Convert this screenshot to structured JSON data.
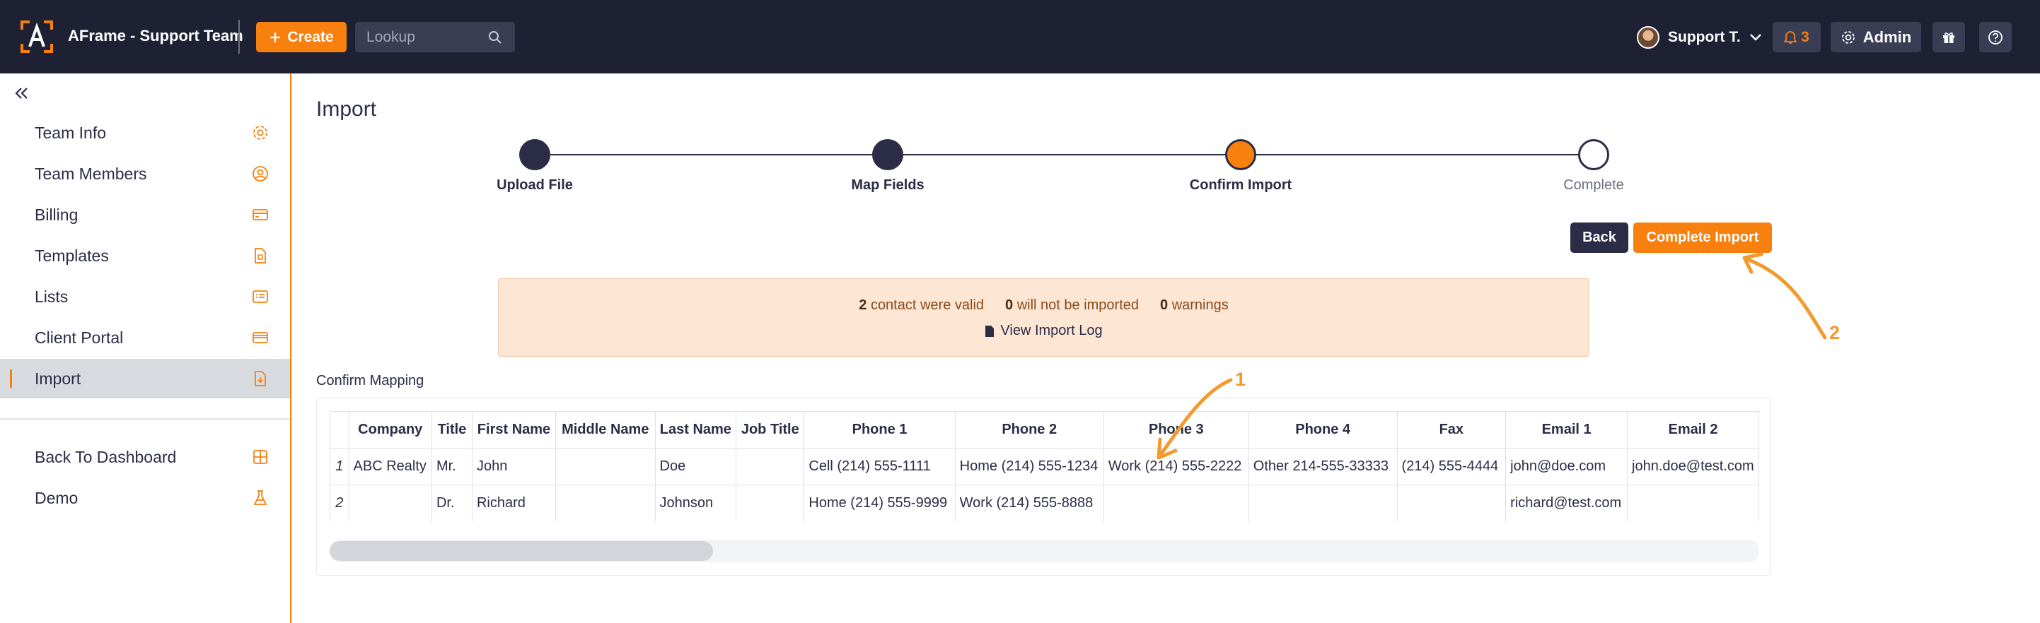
{
  "header": {
    "app_title": "AFrame - Support Team",
    "create_label": "Create",
    "lookup_placeholder": "Lookup",
    "user_name": "Support T.",
    "notification_count": "3",
    "admin_label": "Admin",
    "icons": [
      "aframe-logo-icon",
      "plus-icon",
      "search-icon",
      "chevron-down-icon",
      "bell-icon",
      "gear-icon",
      "gift-icon",
      "help-icon"
    ]
  },
  "sidebar": {
    "items": [
      {
        "label": "Team Info",
        "icon": "gear-icon"
      },
      {
        "label": "Team Members",
        "icon": "user-circle-icon"
      },
      {
        "label": "Billing",
        "icon": "credit-card-icon"
      },
      {
        "label": "Templates",
        "icon": "file-template-icon"
      },
      {
        "label": "Lists",
        "icon": "list-icon"
      },
      {
        "label": "Client Portal",
        "icon": "portal-card-icon"
      },
      {
        "label": "Import",
        "icon": "file-import-icon",
        "active": true
      }
    ],
    "secondary": [
      {
        "label": "Back To Dashboard",
        "icon": "dashboard-grid-icon"
      },
      {
        "label": "Demo",
        "icon": "flask-icon"
      }
    ]
  },
  "main": {
    "title": "Import",
    "steps": [
      {
        "label": "Upload File",
        "state": "done"
      },
      {
        "label": "Map Fields",
        "state": "done"
      },
      {
        "label": "Confirm Import",
        "state": "current"
      },
      {
        "label": "Complete",
        "state": "todo"
      }
    ],
    "back_label": "Back",
    "complete_label": "Complete Import",
    "summary": {
      "valid_count": "2",
      "valid_text": "contact were valid",
      "not_imported_count": "0",
      "not_imported_text": "will not be imported",
      "warnings_count": "0",
      "warnings_text": "warnings",
      "view_log_label": "View Import Log"
    },
    "mapping_label": "Confirm Mapping",
    "table": {
      "columns": [
        "",
        "Company",
        "Title",
        "First Name",
        "Middle Name",
        "Last Name",
        "Job Title",
        "Phone 1",
        "Phone 2",
        "Phone 3",
        "Phone 4",
        "Fax",
        "Email 1",
        "Email 2"
      ],
      "rows": [
        [
          "1",
          "ABC Realty",
          "Mr.",
          "John",
          "",
          "Doe",
          "",
          "Cell (214) 555-1111",
          "Home (214) 555-1234",
          "Work (214) 555-2222",
          "Other 214-555-33333",
          "(214) 555-4444",
          "john@doe.com",
          "john.doe@test.com"
        ],
        [
          "2",
          "",
          "Dr.",
          "Richard",
          "",
          "Johnson",
          "",
          "Home (214) 555-9999",
          "Work (214) 555-8888",
          "",
          "",
          "",
          "richard@test.com",
          ""
        ]
      ]
    },
    "annotations": [
      "1",
      "2"
    ]
  },
  "colors": {
    "topbar": "#1e2134",
    "accent": "#f7800f",
    "dark": "#2a2d45",
    "summary_bg": "#fde6d4",
    "annotation": "#f29a2e"
  }
}
